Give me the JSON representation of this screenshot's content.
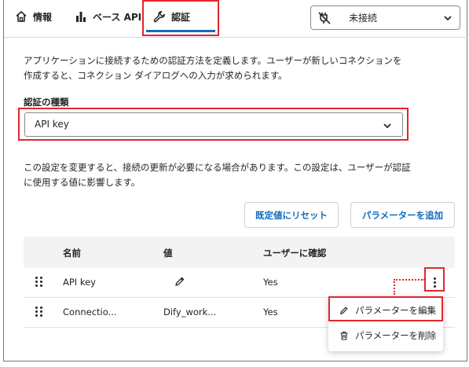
{
  "tabs": [
    {
      "label": "情報",
      "icon": "home-icon"
    },
    {
      "label": "ベース API",
      "icon": "bar-chart-icon"
    },
    {
      "label": "認証",
      "icon": "wrench-icon",
      "selected": true
    }
  ],
  "connection": {
    "label": "未接続",
    "icon": "unplugged-icon"
  },
  "description1": [
    "アプリケーションに接続するための認証方法を定義します。ユーザーが新しいコネクションを",
    "作成すると、コネクション ダイアログへの入力が求められます。"
  ],
  "auth_type": {
    "label": "認証の種類",
    "value": "API key"
  },
  "description2": [
    "この設定を変更すると、接続の更新が必要になる場合があります。この設定は、ユーザーが認証",
    "に使用する値に影響します。"
  ],
  "buttons": {
    "reset": "既定値にリセット",
    "add": "パラメーターを追加"
  },
  "table": {
    "headers": {
      "name": "名前",
      "value": "値",
      "confirm": "ユーザーに確認"
    },
    "rows": [
      {
        "name": "API key",
        "value": "",
        "value_icon": "pencil-icon",
        "confirm": "Yes"
      },
      {
        "name": "Connectio...",
        "value": "Dify_work...",
        "confirm": "Yes"
      }
    ]
  },
  "context_menu": {
    "edit": {
      "label": "パラメーターを編集",
      "icon": "pencil-icon"
    },
    "delete": {
      "label": "パラメーターを削除",
      "icon": "trash-icon"
    }
  },
  "colors": {
    "accent": "#0f6cbd",
    "highlight": "#e3262c"
  }
}
